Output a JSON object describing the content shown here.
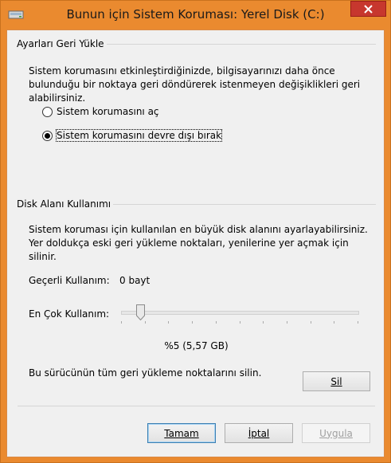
{
  "window": {
    "title": "Bunun için Sistem Koruması: Yerel Disk (C:)",
    "accent_color": "#ea8a2f",
    "close_icon": "close-icon"
  },
  "restore_settings": {
    "group_label": "Ayarları Geri Yükle",
    "description": "Sistem korumasını etkinleştirdiğinizde, bilgisayarınızı daha önce bulunduğu bir noktaya geri döndürerek istenmeyen değişiklikleri geri alabilirsiniz.",
    "options": [
      {
        "label": "Sistem korumasını aç",
        "selected": false
      },
      {
        "label": "Sistem korumasını devre dışı bırak",
        "selected": true
      }
    ]
  },
  "disk_usage": {
    "group_label": "Disk Alanı Kullanımı",
    "description": "Sistem koruması için kullanılan en büyük disk alanını ayarlayabilirsiniz. Yer doldukça eski geri yükleme noktaları, yenilerine yer açmak için silinir.",
    "current_usage_label": "Geçerli Kullanım:",
    "current_usage_value": "0 bayt",
    "max_usage_label": "En Çok Kullanım:",
    "max_usage_percent": 5,
    "max_usage_text": "%5 (5,57 GB)",
    "delete_text": "Bu sürücünün tüm geri yükleme noktalarını silin.",
    "delete_button": "Sil"
  },
  "footer": {
    "ok_button": "Tamam",
    "cancel_button": "İptal",
    "apply_button": "Uygula"
  }
}
